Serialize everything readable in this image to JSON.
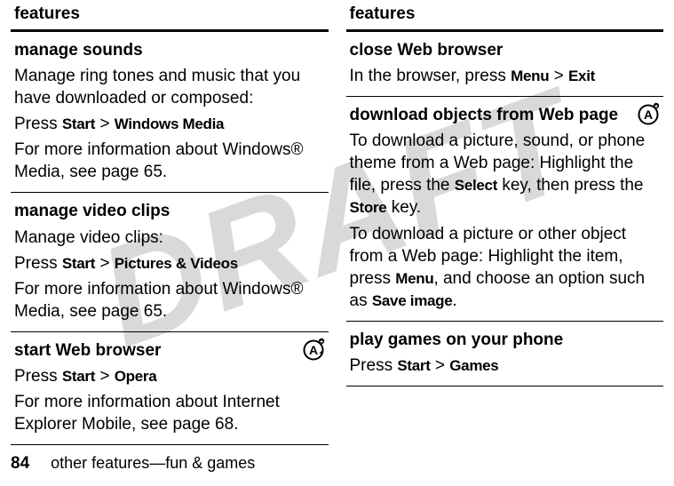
{
  "watermark": "DRAFT",
  "left": {
    "header": "features",
    "cells": [
      {
        "title": "manage sounds",
        "body1": "Manage ring tones and music that you have downloaded or composed:",
        "press": "Press ",
        "menu1": "Start",
        "sep": " > ",
        "menu2": "Windows Media",
        "body2": "For more information about Windows® Media, see page 65."
      },
      {
        "title": "manage video clips",
        "body1": "Manage video clips:",
        "press": "Press ",
        "menu1": "Start",
        "sep": " > ",
        "menu2": "Pictures & Videos",
        "body2": "For more information about Windows® Media, see page 65."
      },
      {
        "title": "start Web browser",
        "press": "Press ",
        "menu1": "Start",
        "sep": " > ",
        "menu2": "Opera",
        "body2": "For more information about Internet Explorer Mobile, see page 68.",
        "icon": true
      }
    ]
  },
  "right": {
    "header": "features",
    "cells": [
      {
        "title": "close Web browser",
        "body1a": "In the browser, press ",
        "menu1": "Menu",
        "sep": " > ",
        "menu2": "Exit"
      },
      {
        "title": "download objects from Web page",
        "body1": "To download a picture, sound, or phone theme from a Web page: Highlight the file, press the ",
        "menu1": "Select",
        "body1b": " key, then press the ",
        "menu2": "Store",
        "body1c": " key.",
        "body2a": "To download a picture or other object from a Web page: Highlight the item, press ",
        "menu3": "Menu",
        "body2b": ", and choose an option such as ",
        "menu4": "Save image",
        "body2c": ".",
        "icon": true
      },
      {
        "title": "play games on your phone",
        "press": "Press ",
        "menu1": "Start",
        "sep": " > ",
        "menu2": "Games"
      }
    ]
  },
  "footer": {
    "page": "84",
    "section": "other features—fun & games"
  }
}
